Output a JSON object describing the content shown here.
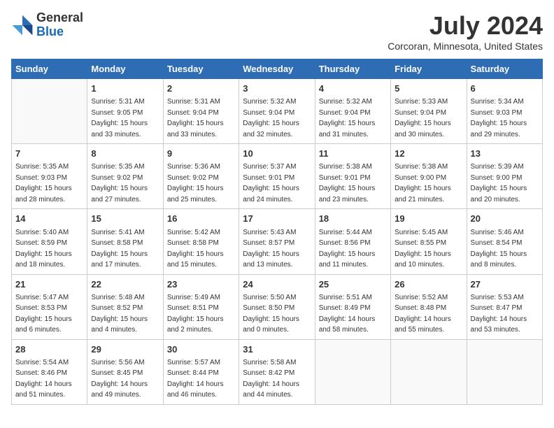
{
  "header": {
    "logo_general": "General",
    "logo_blue": "Blue",
    "month_year": "July 2024",
    "location": "Corcoran, Minnesota, United States"
  },
  "weekdays": [
    "Sunday",
    "Monday",
    "Tuesday",
    "Wednesday",
    "Thursday",
    "Friday",
    "Saturday"
  ],
  "weeks": [
    [
      {
        "day": null,
        "info": null
      },
      {
        "day": "1",
        "info": "Sunrise: 5:31 AM\nSunset: 9:05 PM\nDaylight: 15 hours\nand 33 minutes."
      },
      {
        "day": "2",
        "info": "Sunrise: 5:31 AM\nSunset: 9:04 PM\nDaylight: 15 hours\nand 33 minutes."
      },
      {
        "day": "3",
        "info": "Sunrise: 5:32 AM\nSunset: 9:04 PM\nDaylight: 15 hours\nand 32 minutes."
      },
      {
        "day": "4",
        "info": "Sunrise: 5:32 AM\nSunset: 9:04 PM\nDaylight: 15 hours\nand 31 minutes."
      },
      {
        "day": "5",
        "info": "Sunrise: 5:33 AM\nSunset: 9:04 PM\nDaylight: 15 hours\nand 30 minutes."
      },
      {
        "day": "6",
        "info": "Sunrise: 5:34 AM\nSunset: 9:03 PM\nDaylight: 15 hours\nand 29 minutes."
      }
    ],
    [
      {
        "day": "7",
        "info": "Sunrise: 5:35 AM\nSunset: 9:03 PM\nDaylight: 15 hours\nand 28 minutes."
      },
      {
        "day": "8",
        "info": "Sunrise: 5:35 AM\nSunset: 9:02 PM\nDaylight: 15 hours\nand 27 minutes."
      },
      {
        "day": "9",
        "info": "Sunrise: 5:36 AM\nSunset: 9:02 PM\nDaylight: 15 hours\nand 25 minutes."
      },
      {
        "day": "10",
        "info": "Sunrise: 5:37 AM\nSunset: 9:01 PM\nDaylight: 15 hours\nand 24 minutes."
      },
      {
        "day": "11",
        "info": "Sunrise: 5:38 AM\nSunset: 9:01 PM\nDaylight: 15 hours\nand 23 minutes."
      },
      {
        "day": "12",
        "info": "Sunrise: 5:38 AM\nSunset: 9:00 PM\nDaylight: 15 hours\nand 21 minutes."
      },
      {
        "day": "13",
        "info": "Sunrise: 5:39 AM\nSunset: 9:00 PM\nDaylight: 15 hours\nand 20 minutes."
      }
    ],
    [
      {
        "day": "14",
        "info": "Sunrise: 5:40 AM\nSunset: 8:59 PM\nDaylight: 15 hours\nand 18 minutes."
      },
      {
        "day": "15",
        "info": "Sunrise: 5:41 AM\nSunset: 8:58 PM\nDaylight: 15 hours\nand 17 minutes."
      },
      {
        "day": "16",
        "info": "Sunrise: 5:42 AM\nSunset: 8:58 PM\nDaylight: 15 hours\nand 15 minutes."
      },
      {
        "day": "17",
        "info": "Sunrise: 5:43 AM\nSunset: 8:57 PM\nDaylight: 15 hours\nand 13 minutes."
      },
      {
        "day": "18",
        "info": "Sunrise: 5:44 AM\nSunset: 8:56 PM\nDaylight: 15 hours\nand 11 minutes."
      },
      {
        "day": "19",
        "info": "Sunrise: 5:45 AM\nSunset: 8:55 PM\nDaylight: 15 hours\nand 10 minutes."
      },
      {
        "day": "20",
        "info": "Sunrise: 5:46 AM\nSunset: 8:54 PM\nDaylight: 15 hours\nand 8 minutes."
      }
    ],
    [
      {
        "day": "21",
        "info": "Sunrise: 5:47 AM\nSunset: 8:53 PM\nDaylight: 15 hours\nand 6 minutes."
      },
      {
        "day": "22",
        "info": "Sunrise: 5:48 AM\nSunset: 8:52 PM\nDaylight: 15 hours\nand 4 minutes."
      },
      {
        "day": "23",
        "info": "Sunrise: 5:49 AM\nSunset: 8:51 PM\nDaylight: 15 hours\nand 2 minutes."
      },
      {
        "day": "24",
        "info": "Sunrise: 5:50 AM\nSunset: 8:50 PM\nDaylight: 15 hours\nand 0 minutes."
      },
      {
        "day": "25",
        "info": "Sunrise: 5:51 AM\nSunset: 8:49 PM\nDaylight: 14 hours\nand 58 minutes."
      },
      {
        "day": "26",
        "info": "Sunrise: 5:52 AM\nSunset: 8:48 PM\nDaylight: 14 hours\nand 55 minutes."
      },
      {
        "day": "27",
        "info": "Sunrise: 5:53 AM\nSunset: 8:47 PM\nDaylight: 14 hours\nand 53 minutes."
      }
    ],
    [
      {
        "day": "28",
        "info": "Sunrise: 5:54 AM\nSunset: 8:46 PM\nDaylight: 14 hours\nand 51 minutes."
      },
      {
        "day": "29",
        "info": "Sunrise: 5:56 AM\nSunset: 8:45 PM\nDaylight: 14 hours\nand 49 minutes."
      },
      {
        "day": "30",
        "info": "Sunrise: 5:57 AM\nSunset: 8:44 PM\nDaylight: 14 hours\nand 46 minutes."
      },
      {
        "day": "31",
        "info": "Sunrise: 5:58 AM\nSunset: 8:42 PM\nDaylight: 14 hours\nand 44 minutes."
      },
      {
        "day": null,
        "info": null
      },
      {
        "day": null,
        "info": null
      },
      {
        "day": null,
        "info": null
      }
    ]
  ]
}
